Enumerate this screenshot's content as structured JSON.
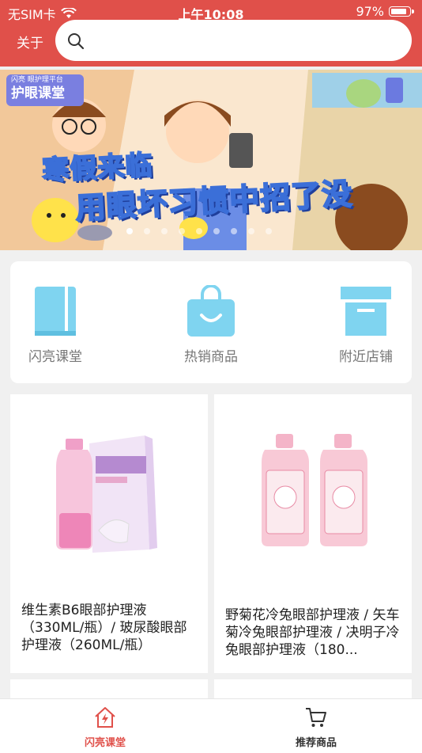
{
  "status_bar": {
    "carrier": "无SIM卡",
    "time": "上午10:08",
    "battery": "97%"
  },
  "header": {
    "about_label": "关于",
    "search_placeholder": ""
  },
  "banner": {
    "logo_small": "闪亮 眼护理平台",
    "logo_big": "护眼课堂",
    "headline_1": "寒假来临",
    "headline_2": "用眼坏习惯中招了没",
    "dots_count": 9,
    "active_dot": 0
  },
  "menu": {
    "items": [
      {
        "label": "闪亮课堂",
        "icon": "book-icon"
      },
      {
        "label": "热销商品",
        "icon": "shopping-bag-icon"
      },
      {
        "label": "附近店铺",
        "icon": "archive-box-icon"
      }
    ]
  },
  "products": [
    {
      "title": "维生素B6眼部护理液（330ML/瓶）/ 玻尿酸眼部护理液（260ML/瓶）",
      "image": "eye-care-solution-bottle-with-box"
    },
    {
      "title": "野菊花冷兔眼部护理液 / 矢车菊冷兔眼部护理液 / 决明子冷兔眼部护理液（180...",
      "image": "two-pink-eye-care-bottles"
    }
  ],
  "tabbar": {
    "tabs": [
      {
        "label": "闪亮课堂",
        "icon": "home-lightning-icon",
        "active": true
      },
      {
        "label": "推荐商品",
        "icon": "cart-icon",
        "active": false
      }
    ]
  },
  "colors": {
    "brand_red": "#e0504a",
    "icon_blue": "#7fd4f0",
    "background": "#f0f0f0"
  }
}
